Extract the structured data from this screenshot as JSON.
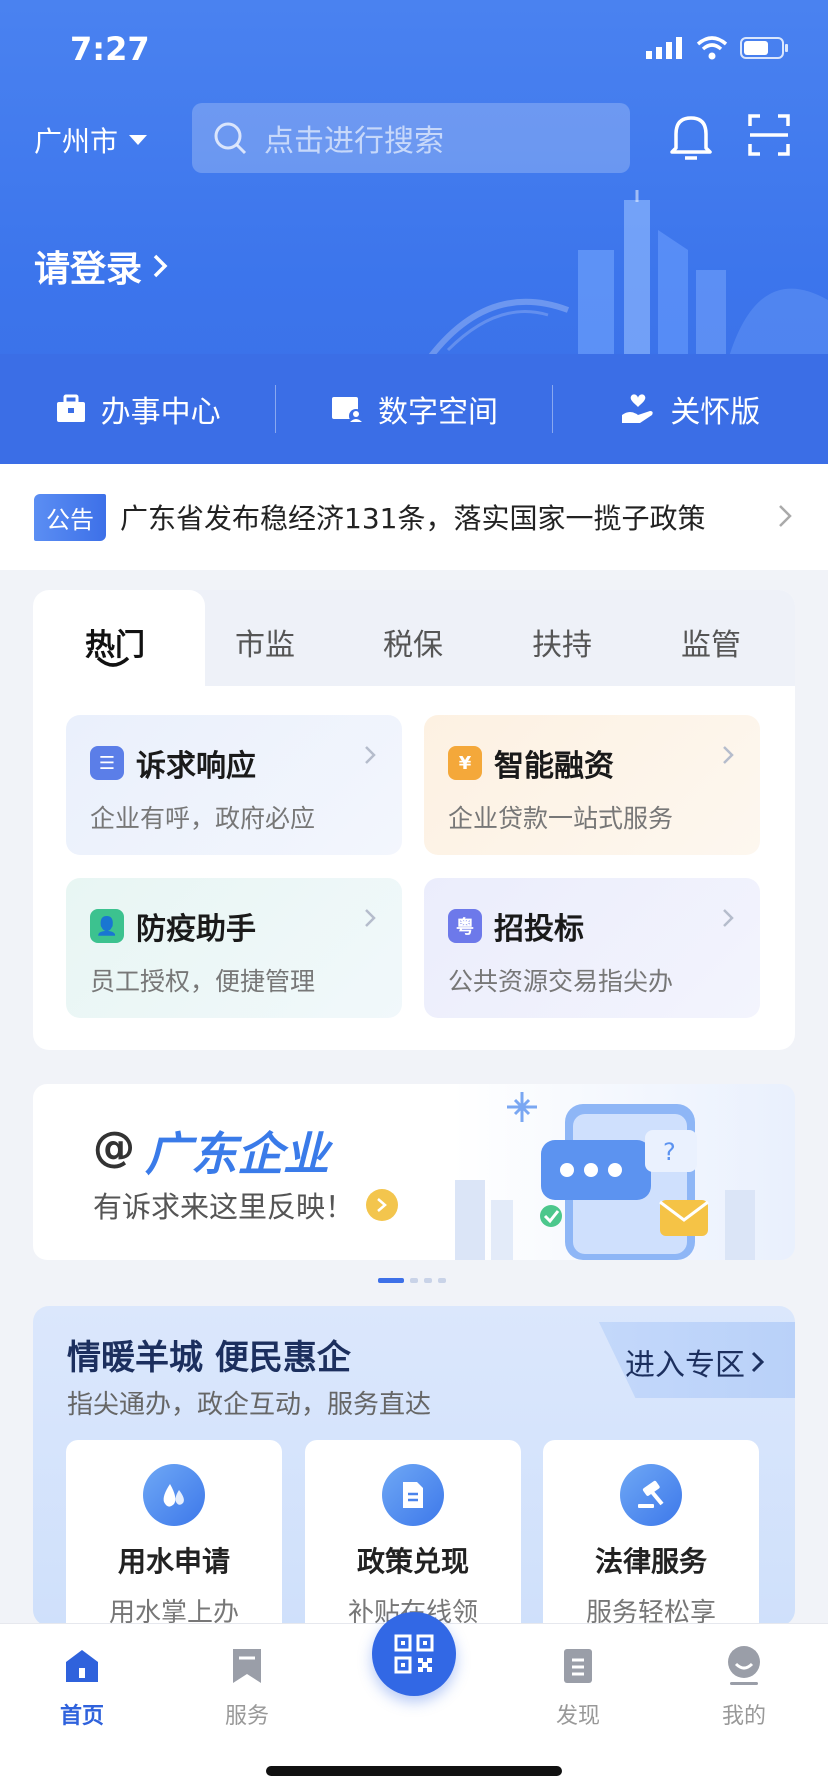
{
  "status": {
    "time": "7:27"
  },
  "header": {
    "city": "广州市",
    "search_placeholder": "点击进行搜索",
    "login": "请登录"
  },
  "quick": [
    {
      "label": "办事中心"
    },
    {
      "label": "数字空间"
    },
    {
      "label": "关怀版"
    }
  ],
  "notice": {
    "badge": "公告",
    "text": "广东省发布稳经济131条，落实国家一揽子政策"
  },
  "tabs": [
    "热门",
    "市监",
    "税保",
    "扶持",
    "监管"
  ],
  "services": [
    {
      "title": "诉求响应",
      "sub": "企业有呼，政府必应",
      "icon": "list-icon",
      "color": "#5b7ee8",
      "bg": "#eef2fb"
    },
    {
      "title": "智能融资",
      "sub": "企业贷款一站式服务",
      "icon": "yuan-icon",
      "color": "#f4a83a",
      "bg": "#fdf5ea"
    },
    {
      "title": "防疫助手",
      "sub": "员工授权，便捷管理",
      "icon": "user-icon",
      "color": "#3cc28f",
      "bg": "#eef8f6"
    },
    {
      "title": "招投标",
      "sub": "公共资源交易指尖办",
      "icon": "yue-icon",
      "color": "#6d79ea",
      "bg": "#eff0fd"
    }
  ],
  "banner": {
    "at": "@",
    "title": "广东企业",
    "sub": "有诉求来这里反映！"
  },
  "zone": {
    "title": "情暖羊城 便民惠企",
    "sub": "指尖通办，政企互动，服务直达",
    "enter": "进入专区",
    "cards": [
      {
        "title": "用水申请",
        "sub": "用水掌上办",
        "icon": "water-drop-icon"
      },
      {
        "title": "政策兑现",
        "sub": "补贴在线领",
        "icon": "document-icon"
      },
      {
        "title": "法律服务",
        "sub": "服务轻松享",
        "icon": "gavel-icon"
      }
    ]
  },
  "nav": [
    {
      "label": "首页"
    },
    {
      "label": "服务"
    },
    {
      "label": "发现"
    },
    {
      "label": "我的"
    }
  ]
}
